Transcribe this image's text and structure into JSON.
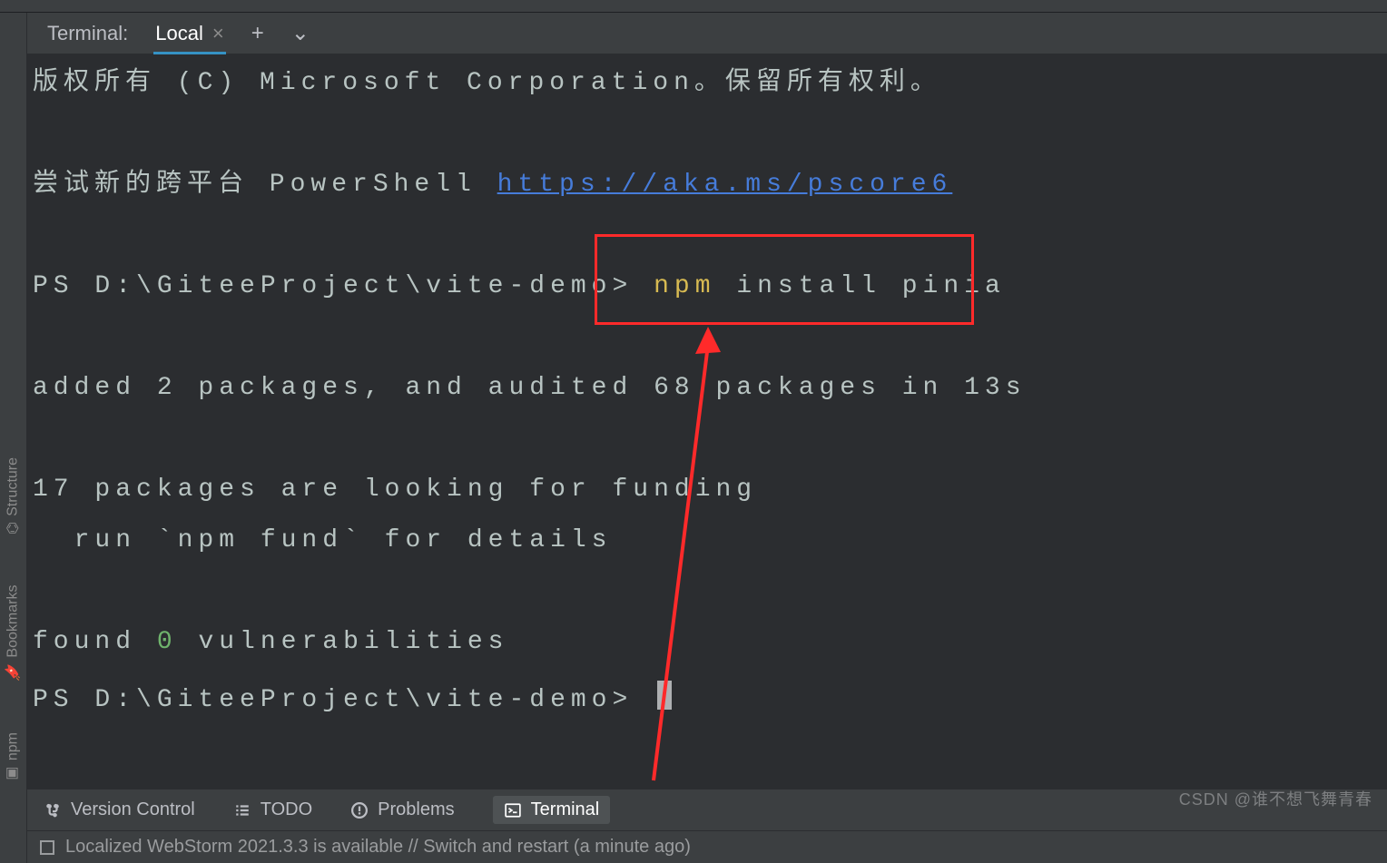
{
  "tabbar": {
    "title": "Terminal:",
    "tab_local": "Local"
  },
  "terminal": {
    "copyright_prefix_cn": "版权所有 (C) ",
    "copyright_company": "Microsoft Corporation",
    "copyright_suffix_cn": "。保留所有权利。",
    "try_cn": "尝试新的跨平台 PowerShell ",
    "pscore_url": "https://aka.ms/pscore6",
    "prompt1": "PS D:\\GiteeProject\\vite-demo> ",
    "cmd_npm": "npm",
    "cmd_rest": " install pinia",
    "added_line": "added 2 packages, and audited 68 packages in 13s",
    "funding_1": "17 packages are looking for funding",
    "funding_2": "  run `npm fund` for details",
    "found_pre": "found ",
    "found_zero": "0",
    "found_post": " vulnerabilities",
    "prompt2": "PS D:\\GiteeProject\\vite-demo> "
  },
  "sidebar": {
    "structure": "Structure",
    "bookmarks": "Bookmarks",
    "npm": "npm"
  },
  "bottombar": {
    "vc": "Version Control",
    "todo": "TODO",
    "problems": "Problems",
    "terminal": "Terminal"
  },
  "statusbar": {
    "msg": "Localized WebStorm 2021.3.3 is available // Switch and restart (a minute ago)"
  },
  "watermark": "CSDN @谁不想飞舞青春"
}
